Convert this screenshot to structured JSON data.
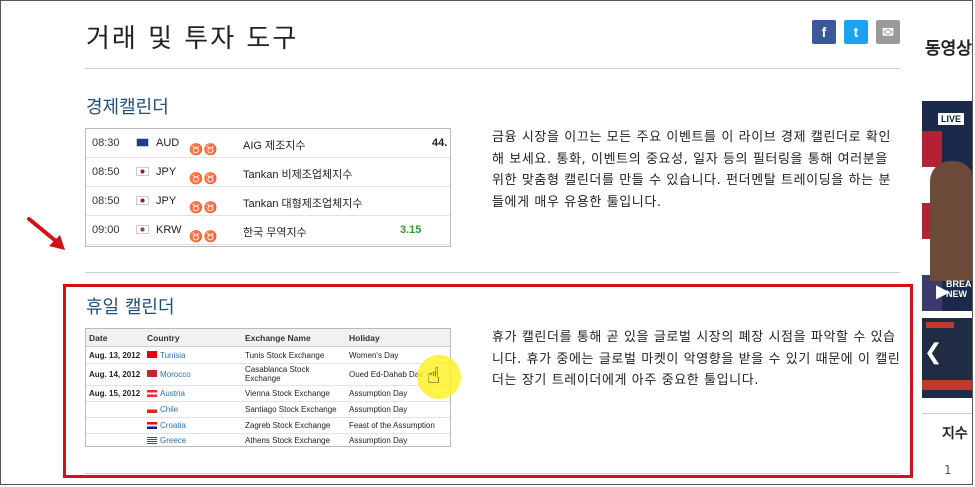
{
  "page": {
    "title": "거래 및 투자 도구"
  },
  "share": {
    "facebook": "f",
    "twitter": "t",
    "email": "✉"
  },
  "economic_calendar": {
    "title": "경제캘린더",
    "description": "금융 시장을 이끄는 모든 주요 이벤트를 이 라이브 경제 캘린더로 확인해 보세요. 통화, 이벤트의 중요성, 일자 등의 필터링을 통해 여러분을 위한 맞춤형 캘린더를 만들 수 있습니다. 펀더멘탈 트레이딩을 하는 분들에게 매우 유용한 툴입니다.",
    "rows": [
      {
        "time": "08:30",
        "currency": "AUD",
        "importance": 1,
        "event": "AIG 제조지수",
        "value": "44.",
        "flag_color": "#1a3d8f"
      },
      {
        "time": "08:50",
        "currency": "JPY",
        "importance": 1,
        "event": "Tankan 비제조업체지수",
        "value": "",
        "flag_color": "#ffffff"
      },
      {
        "time": "08:50",
        "currency": "JPY",
        "importance": 2,
        "event": "Tankan 대형제조업체지수",
        "value": "",
        "flag_color": "#ffffff"
      },
      {
        "time": "09:00",
        "currency": "KRW",
        "importance": 1,
        "event": "한국 무역지수",
        "value": "3.15",
        "flag_color": "#ffffff"
      }
    ]
  },
  "holiday_calendar": {
    "title": "휴일 캘린더",
    "description": "휴가 캘린더를 통해 곧 있을 글로벌 시장의 폐장 시점을 파악할 수 있습니다. 휴가 중에는 글로벌 마켓이 악영향을 받을 수 있기 때문에 이 캘린더는 장기 트레이더에게 아주 중요한 툴입니다.",
    "headers": [
      "Date",
      "Country",
      "Exchange Name",
      "Holiday"
    ],
    "rows": [
      {
        "date": "Aug. 13, 2012",
        "country": "Tunisia",
        "exchange": "Tunis Stock Exchange",
        "holiday": "Women's Day",
        "flag_color": "#e70013"
      },
      {
        "date": "Aug. 14, 2012",
        "country": "Morocco",
        "exchange": "Casablanca Stock Exchange",
        "holiday": "Oued Ed-Dahab Day",
        "flag_color": "#c1272d"
      },
      {
        "date": "Aug. 15, 2012",
        "country": "Austria",
        "exchange": "Vienna Stock Exchange",
        "holiday": "Assumption Day",
        "flag_color": "#ed2939"
      },
      {
        "date": "",
        "country": "Chile",
        "exchange": "Santiago Stock Exchange",
        "holiday": "Assumption Day",
        "flag_color": "#0039a6"
      },
      {
        "date": "",
        "country": "Croatia",
        "exchange": "Zagreb Stock Exchange",
        "holiday": "Feast of the Assumption",
        "flag_color": "#ff0000"
      },
      {
        "date": "",
        "country": "Greece",
        "exchange": "Athens Stock Exchange",
        "holiday": "Assumption Day",
        "flag_color": "#0d5eaf"
      }
    ]
  },
  "sidebar": {
    "title": "동영상",
    "video_badge": "LIVE",
    "video_caption": "BREA NEW",
    "prev_arrow": "❮",
    "index_label": "지수",
    "index_number": "1"
  },
  "annotations": {
    "highlight_color": "#d0121b"
  }
}
